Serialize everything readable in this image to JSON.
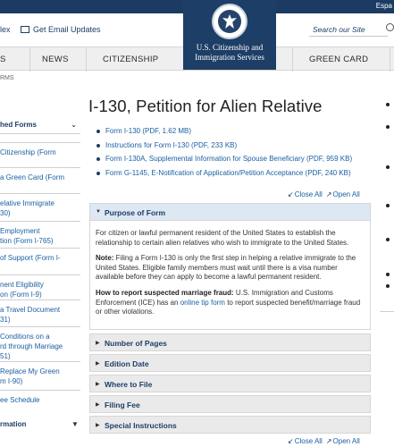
{
  "topbar": {
    "language_label": "Espa"
  },
  "utility": {
    "index_label": "lex",
    "email_label": "Get Email Updates",
    "search_placeholder": "Search our Site"
  },
  "logo": {
    "line1": "U.S. Citizenship and",
    "line2": "Immigration Services"
  },
  "nav": {
    "items": [
      "S",
      "NEWS",
      "CITIZENSHIP",
      "GREEN CARD"
    ]
  },
  "breadcrumb": "RMS",
  "sidebar": {
    "heading": "hed Forms",
    "items": [
      [
        "Citizenship (Form"
      ],
      [
        "a Green Card (Form"
      ],
      [
        "elative Immigrate",
        "30)"
      ],
      [
        "Employment",
        "tion (Form I-765)"
      ],
      [
        "of Support (Form I-"
      ],
      [
        "nent Eligibility",
        "on (Form I-9)"
      ],
      [
        "a Travel Document",
        "31)"
      ],
      [
        "Conditions on a",
        "rd through Marriage",
        "51)"
      ],
      [
        "Replace My Green",
        "m I-90)"
      ],
      [
        "ee Schedule"
      ]
    ],
    "bottom_heading": "rmation"
  },
  "main": {
    "title": "I-130, Petition for Alien Relative",
    "documents": [
      "Form I-130 (PDF, 1.62 MB)",
      "Instructions for Form I-130 (PDF, 233 KB)",
      "Form I-130A, Supplemental Information for Spouse Beneficiary (PDF, 959 KB)",
      "Form G-1145, E-Notification of Application/Petition Acceptance (PDF, 240 KB)"
    ],
    "close_all": "Close All",
    "open_all": "Open All",
    "purpose": {
      "heading": "Purpose of Form",
      "para1": "For citizen or lawful permanent resident of the United States to establish the relationship to certain alien relatives who wish to immigrate to the United States.",
      "note_label": "Note:",
      "note_text": " Filing a Form I-130 is only the first step in helping a relative immigrate to the United States. Eligible family members must wait until there is a visa number available before they can apply to become a lawful permanent resident.",
      "fraud_label": "How to report suspected marriage fraud:",
      "fraud_text1": " U.S. Immigration and Customs Enforcement (ICE) has an ",
      "fraud_link": "online tip form",
      "fraud_text2": " to report suspected benefit/marriage fraud or other violations."
    },
    "sections": [
      "Number of Pages",
      "Edition Date",
      "Where to File",
      "Filing Fee",
      "Special Instructions"
    ]
  }
}
